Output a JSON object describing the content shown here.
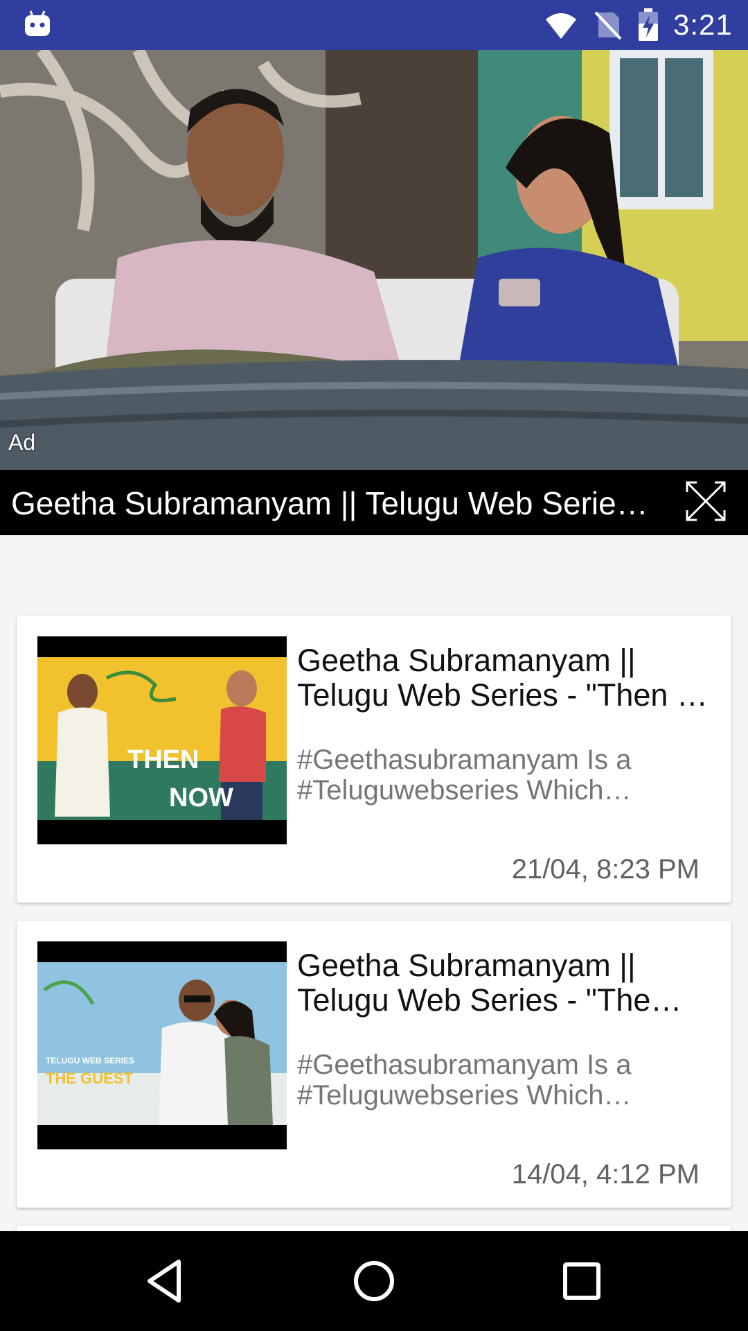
{
  "status_bar": {
    "time": "3:21",
    "icons": [
      "android-icon",
      "wifi-icon",
      "no-sim-icon",
      "battery-charging-icon"
    ]
  },
  "ad": {
    "label": "Ad",
    "title": "Geetha Subramanyam || Telugu Web Series - \"The Guest\"",
    "fullscreen_icon": "fullscreen-icon"
  },
  "videos": [
    {
      "title": "Geetha Subramanyam || Telugu Web Series - \"Then & Now\"",
      "description": "#Geethasubramanyam Is a #Teluguwebseries Which explores the lives of young couples",
      "date": "21/04, 8:23 PM",
      "thumb_text": [
        "THEN",
        "NOW"
      ]
    },
    {
      "title": "Geetha Subramanyam || Telugu Web Series - \"The Guest\"",
      "description": "#Geethasubramanyam Is a #Teluguwebseries Which explores the lives of young couples",
      "date": "14/04, 4:12 PM",
      "thumb_text": [
        "TELUGU WEB SERIES",
        "THE GUEST"
      ]
    }
  ],
  "nav_bar": {
    "icons": [
      "back-icon",
      "home-icon",
      "recents-icon"
    ]
  },
  "colors": {
    "status_bar": "#303f9f",
    "background": "#f5f5f5",
    "card": "#ffffff",
    "nav_bar": "#000000"
  }
}
